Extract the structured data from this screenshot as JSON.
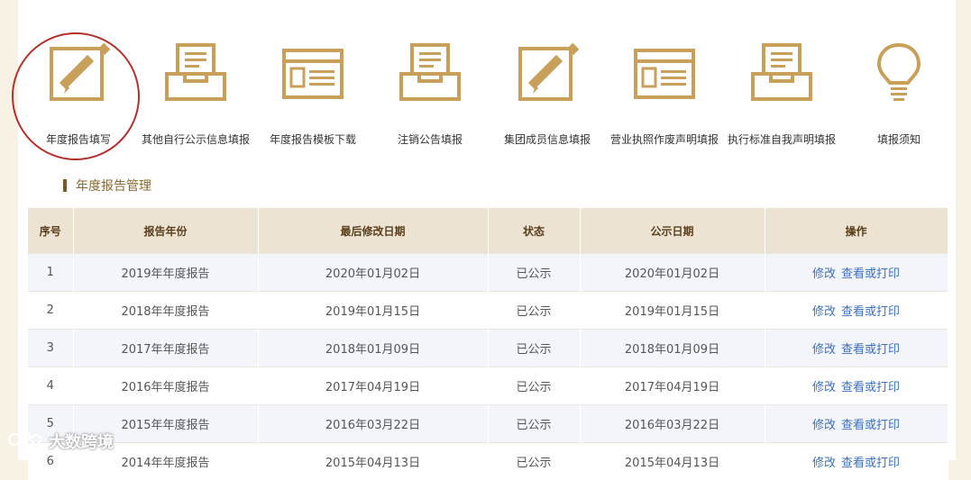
{
  "icons": [
    {
      "label": "年度报告填写",
      "icon": "pencil-icon"
    },
    {
      "label": "其他自行公示信息填报",
      "icon": "inbox-icon"
    },
    {
      "label": "年度报告模板下载",
      "icon": "template-icon"
    },
    {
      "label": "注销公告填报",
      "icon": "inbox-icon"
    },
    {
      "label": "集团成员信息填报",
      "icon": "pencil-icon"
    },
    {
      "label": "营业执照作废声明填报",
      "icon": "template-icon"
    },
    {
      "label": "执行标准自我声明填报",
      "icon": "inbox-icon"
    },
    {
      "label": "填报须知",
      "icon": "lightbulb-icon"
    }
  ],
  "colors": {
    "accent": "#c9a05a",
    "title": "#8c6a33",
    "header_bg": "#ede3d3",
    "link": "#3b6fc2",
    "highlight": "#b4302a"
  },
  "section": {
    "title": "年度报告管理"
  },
  "table": {
    "headers": [
      "序号",
      "报告年份",
      "最后修改日期",
      "状态",
      "公示日期",
      "操作"
    ],
    "rows": [
      {
        "no": "1",
        "year": "2019年年度报告",
        "modified": "2020年01月02日",
        "status": "已公示",
        "published": "2020年01月02日",
        "edit": "修改",
        "view": "查看或打印"
      },
      {
        "no": "2",
        "year": "2018年年度报告",
        "modified": "2019年01月15日",
        "status": "已公示",
        "published": "2019年01月15日",
        "edit": "修改",
        "view": "查看或打印"
      },
      {
        "no": "3",
        "year": "2017年年度报告",
        "modified": "2018年01月09日",
        "status": "已公示",
        "published": "2018年01月09日",
        "edit": "修改",
        "view": "查看或打印"
      },
      {
        "no": "4",
        "year": "2016年年度报告",
        "modified": "2017年04月19日",
        "status": "已公示",
        "published": "2017年04月19日",
        "edit": "修改",
        "view": "查看或打印"
      },
      {
        "no": "5",
        "year": "2015年年度报告",
        "modified": "2016年03月22日",
        "status": "已公示",
        "published": "2016年03月22日",
        "edit": "修改",
        "view": "查看或打印"
      },
      {
        "no": "6",
        "year": "2014年年度报告",
        "modified": "2015年04月13日",
        "status": "已公示",
        "published": "2015年04月13日",
        "edit": "修改",
        "view": "查看或打印"
      }
    ]
  },
  "watermark": {
    "text": "大数跨境"
  }
}
